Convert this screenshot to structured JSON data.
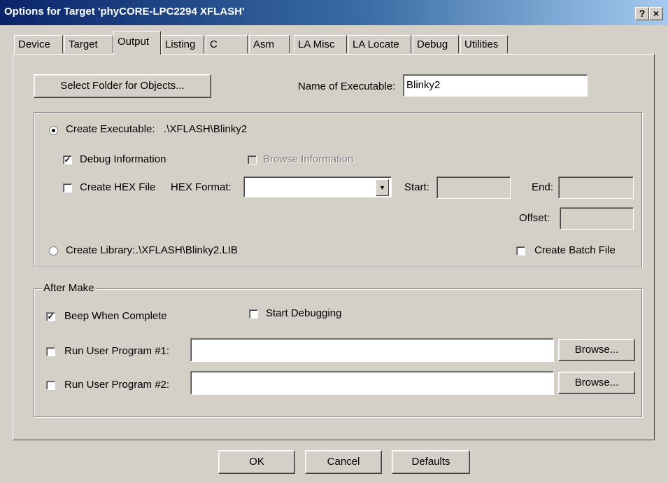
{
  "window": {
    "title": "Options for Target 'phyCORE-LPC2294 XFLASH'",
    "help_glyph": "?",
    "close_glyph": "×"
  },
  "tabs": [
    "Device",
    "Target",
    "Output",
    "Listing",
    "C",
    "Asm",
    "LA Misc",
    "LA Locate",
    "Debug",
    "Utilities"
  ],
  "active_tab": "Output",
  "output": {
    "select_folder_button": "Select Folder for Objects...",
    "name_exe_label": "Name of Executable:",
    "name_exe_value": "Blinky2",
    "create_exe_label": "Create Executable:",
    "create_exe_path": ".\\XFLASH\\Blinky2",
    "debug_info_label": "Debug Information",
    "browse_info_label": "Browse Information",
    "create_hex_label": "Create HEX File",
    "hex_format_label": "HEX Format:",
    "hex_format_value": "",
    "start_label": "Start:",
    "start_value": "",
    "end_label": "End:",
    "end_value": "",
    "offset_label": "Offset:",
    "offset_value": "",
    "create_lib_label": "Create Library:",
    "create_lib_path": ".\\XFLASH\\Blinky2.LIB",
    "batch_file_label": "Create Batch File"
  },
  "after_make": {
    "legend": "After Make",
    "beep_label": "Beep When Complete",
    "start_debug_label": "Start Debugging",
    "run1_label": "Run User Program #1:",
    "run1_value": "",
    "run2_label": "Run User Program #2:",
    "run2_value": "",
    "browse_label": "Browse..."
  },
  "footer": {
    "ok": "OK",
    "cancel": "Cancel",
    "defaults": "Defaults"
  },
  "state": {
    "create_executable": true,
    "debug_information": true,
    "browse_information": false,
    "create_hex": false,
    "create_batch": false,
    "beep_when_complete": true,
    "start_debugging": false,
    "run1": false,
    "run2": false
  },
  "colors": {
    "titlebar_start": "#0a246a",
    "titlebar_end": "#a6caf0",
    "dialog_face": "#d4d0c8"
  }
}
